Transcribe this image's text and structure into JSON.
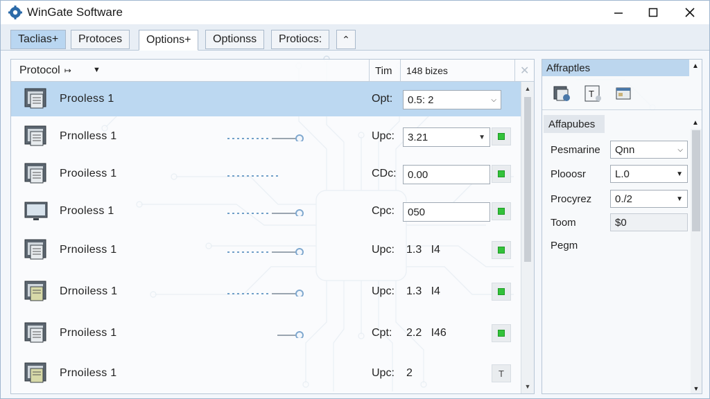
{
  "window": {
    "title": "WinGate Software",
    "minimize_icon": "minimize-icon",
    "maximize_icon": "maximize-icon",
    "close_icon": "close-icon"
  },
  "tabs": [
    {
      "label": "Taclias+"
    },
    {
      "label": "Protoces"
    },
    {
      "label": "Options+"
    },
    {
      "label": "Optionss"
    },
    {
      "label": "Protiocs:"
    }
  ],
  "tab_scroll_icon": "chevron-up-icon",
  "list": {
    "header": {
      "protocol": "Protocol",
      "time": "Tim",
      "size": "148 bizes"
    },
    "rows": [
      {
        "name": "Prooless 1",
        "label": "Opt:",
        "value": "0.5: 2",
        "kind": "dropdown",
        "status": "none",
        "selected": true
      },
      {
        "name": "Prnolless 1",
        "label": "Upc:",
        "value": "3.21",
        "kind": "dropdown",
        "status": "green"
      },
      {
        "name": "Prooiless 1",
        "label": "CDc:",
        "value": "0.00",
        "kind": "input",
        "status": "green"
      },
      {
        "name": "Prooless 1",
        "label": "Cpc:",
        "value": "050",
        "kind": "input",
        "status": "green"
      },
      {
        "name": "Prnoiless 1",
        "label": "Upc:",
        "value": "1.3   I4",
        "kind": "plain",
        "status": "green"
      },
      {
        "name": "Drnoiless 1",
        "label": "Upc:",
        "value": "1.3   I4",
        "kind": "plain",
        "status": "green"
      },
      {
        "name": "Prnoiless 1",
        "label": "Cpt:",
        "value": "2.2   I46",
        "kind": "plain",
        "status": "green"
      },
      {
        "name": "Prnoiless 1",
        "label": "Upc:",
        "value": "2",
        "kind": "plain",
        "status": "text",
        "status_text": "T"
      }
    ]
  },
  "right_panel": {
    "top_title": "Affraptles",
    "section_title": "Affapubes",
    "properties": [
      {
        "label": "Pesmarine",
        "value": "Qnn",
        "kind": "dropdown"
      },
      {
        "label": "Plooosr",
        "value": "L.0",
        "kind": "dropdown"
      },
      {
        "label": "Procyrez",
        "value": "0./2",
        "kind": "dropdown"
      },
      {
        "label": "Toom",
        "value": "$0",
        "kind": "flat"
      },
      {
        "label": "Pegm",
        "value": "",
        "kind": "none"
      }
    ]
  },
  "colors": {
    "accent": "#bcd8f1",
    "status_green": "#33c23a"
  }
}
